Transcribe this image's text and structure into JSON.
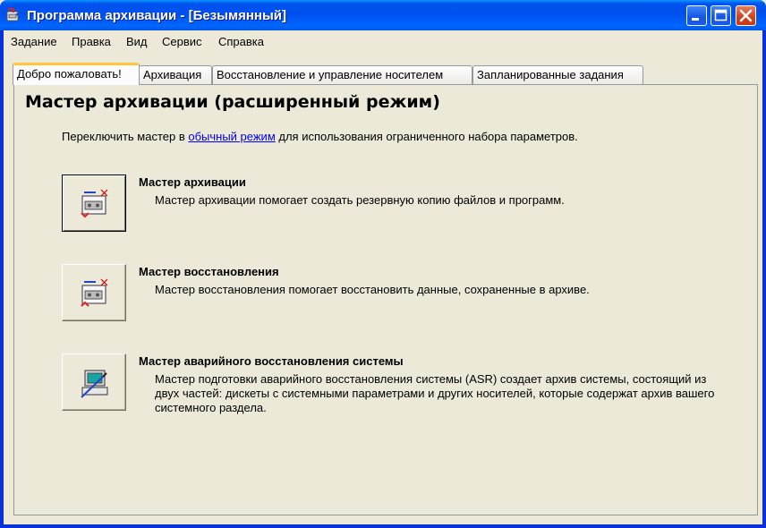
{
  "window": {
    "title": "Программа архивации - [Безымянный]"
  },
  "menu": [
    "Задание",
    "Правка",
    "Вид",
    "Сервис",
    "Справка"
  ],
  "tabs": [
    "Добро пожаловать!",
    "Архивация",
    "Восстановление и управление носителем",
    "Запланированные задания"
  ],
  "active_tab": 0,
  "main": {
    "heading": "Мастер архивации (расширенный режим)",
    "switch_prefix": "Переключить мастер в ",
    "switch_link": "обычный режим",
    "switch_suffix": " для использования ограниченного набора параметров."
  },
  "wizards": [
    {
      "icon": "backup-wizard-icon",
      "title": "Мастер архивации",
      "description": "Мастер архивации помогает создать резервную копию файлов и программ."
    },
    {
      "icon": "restore-wizard-icon",
      "title": "Мастер восстановления",
      "description": "Мастер восстановления помогает восстановить данные, сохраненные в архиве."
    },
    {
      "icon": "asr-wizard-icon",
      "title": "Мастер аварийного восстановления системы",
      "description": "Мастер подготовки аварийного восстановления системы (ASR) создает архив системы, состоящий из двух частей: дискеты с системными параметрами и других носителей, которые содержат архив вашего системного раздела."
    }
  ],
  "colors": {
    "titlebar": "#0053ee",
    "link": "#0000ee",
    "active_tab_accent": "#ffc83c",
    "close_button": "#d2401a"
  }
}
